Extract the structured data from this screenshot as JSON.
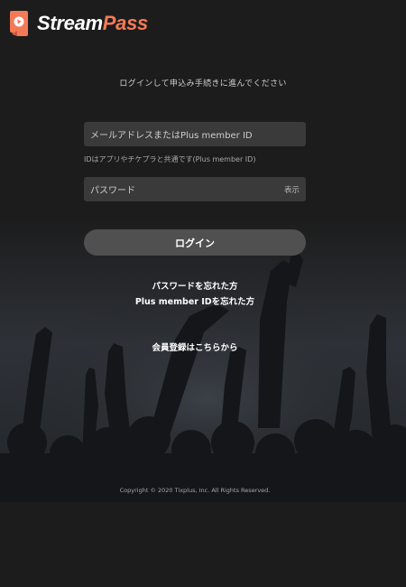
{
  "header": {
    "logo_icon": "play-ticket-icon",
    "brand_primary": "Stream",
    "brand_accent": "Pass",
    "accent_color": "#f47a57"
  },
  "login": {
    "intro": "ログインして申込み手続きに進んでください",
    "email_placeholder": "メールアドレスまたはPlus member ID",
    "email_hint": "IDはアプリやチケプラと共通です(Plus member ID)",
    "password_placeholder": "パスワード",
    "show_password": "表示",
    "login_button": "ログイン",
    "forgot_password": "パスワードを忘れた方",
    "forgot_id": "Plus member IDを忘れた方",
    "register": "会員登録はこちらから"
  },
  "footer": {
    "copyright": "Copyright © 2020 Tixplus, Inc. All Rights Reserved."
  }
}
